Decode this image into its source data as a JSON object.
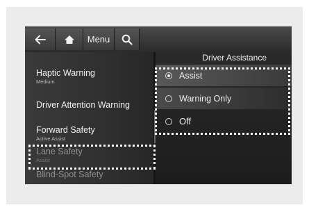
{
  "topbar": {
    "back_icon": "arrow-left-icon",
    "home_icon": "home-icon",
    "menu_label": "Menu",
    "search_icon": "search-icon"
  },
  "left_menu": {
    "items": [
      {
        "label": "Haptic Warning",
        "sub": "Medium"
      },
      {
        "label": "Driver Attention Warning",
        "sub": ""
      },
      {
        "label": "Forward Safety",
        "sub": "Active Assist"
      },
      {
        "label": "Lane Safety",
        "sub": "Assist"
      },
      {
        "label": "Blind-Spot Safety",
        "sub": ""
      }
    ]
  },
  "right_panel": {
    "title": "Driver Assistance",
    "options": [
      {
        "label": "Assist",
        "selected": true
      },
      {
        "label": "Warning Only",
        "selected": false
      },
      {
        "label": "Off",
        "selected": false
      }
    ]
  },
  "colors": {
    "highlight_outline": "#ffffff",
    "panel_dark": "#1f1f1f",
    "frame_bg": "#ececec"
  }
}
